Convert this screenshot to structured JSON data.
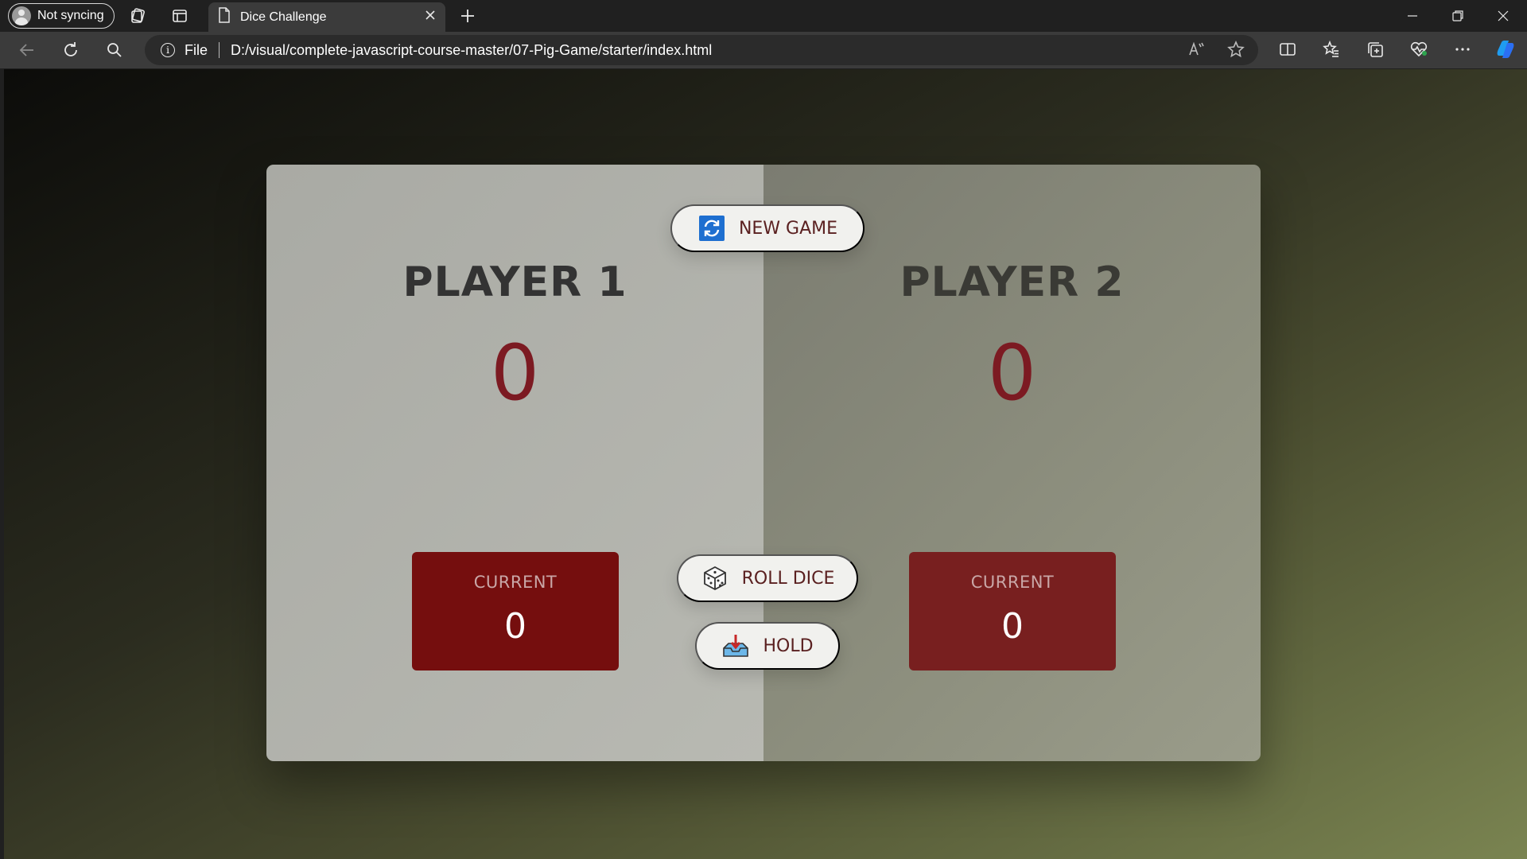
{
  "browser": {
    "profile_label": "Not syncing",
    "tab_title": "Dice Challenge",
    "address_scheme": "File",
    "address_url": "D:/visual/complete-javascript-course-master/07-Pig-Game/starter/index.html"
  },
  "game": {
    "new_game_label": "NEW GAME",
    "roll_dice_label": "ROLL DICE",
    "hold_label": "HOLD",
    "players": [
      {
        "name": "PLAYER 1",
        "score": "0",
        "current_label": "CURRENT",
        "current_score": "0"
      },
      {
        "name": "PLAYER 2",
        "score": "0",
        "current_label": "CURRENT",
        "current_score": "0"
      }
    ]
  },
  "colors": {
    "score": "#7c1a22",
    "current_active": "#750e0e",
    "current_inactive": "#781f1f",
    "button_text": "#5a2020"
  }
}
